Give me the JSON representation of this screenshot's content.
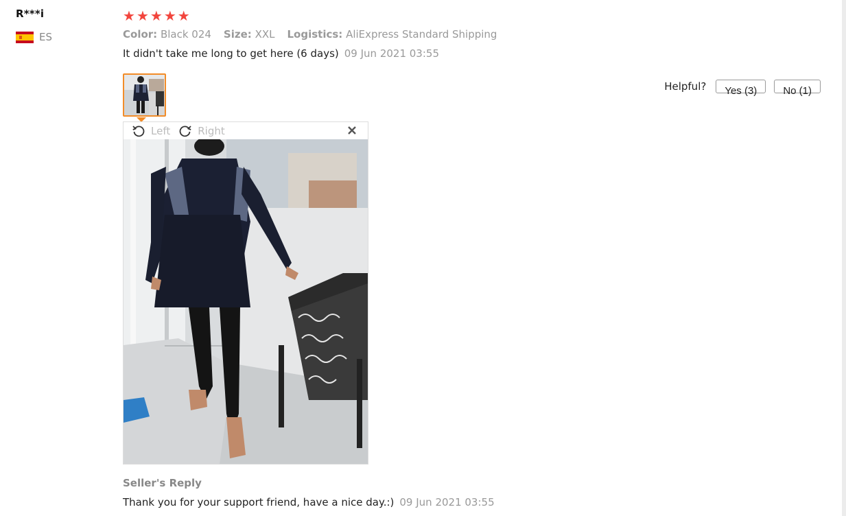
{
  "reviewer": {
    "name": "R***i",
    "country_code": "ES",
    "flag_icon": "spain-flag-icon"
  },
  "review": {
    "rating": 5,
    "rating_max": 5,
    "star_color": "#f2453d",
    "attributes": [
      {
        "label": "Color:",
        "value": "Black 024"
      },
      {
        "label": "Size:",
        "value": "XXL"
      },
      {
        "label": "Logistics:",
        "value": "AliExpress Standard Shipping"
      }
    ],
    "text": "It didn't take me long to get here (6 days)",
    "date": "09 Jun 2021 03:55"
  },
  "helpful": {
    "label": "Helpful?",
    "yes": "Yes (3)",
    "no": "No (1)"
  },
  "viewer": {
    "rotate_left": "Left",
    "rotate_right": "Right",
    "close_icon": "close-icon",
    "accent_color": "#f28c28"
  },
  "seller_reply": {
    "title": "Seller's Reply",
    "text": "Thank you for your support friend, have a nice day.:)",
    "date": "09 Jun 2021 03:55"
  }
}
